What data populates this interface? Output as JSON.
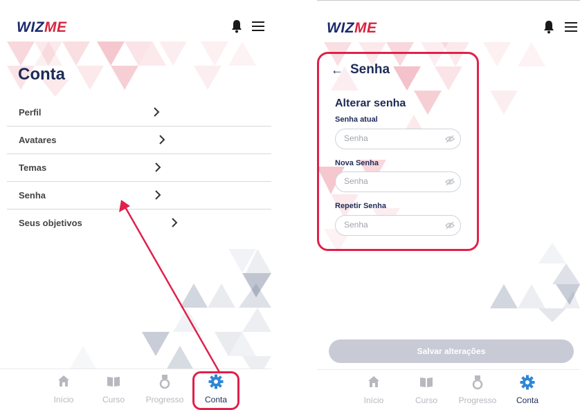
{
  "left_screen": {
    "logo": {
      "part1": "WIZ",
      "part2": "ME"
    },
    "header_title": "Conta",
    "menu": [
      "Perfil",
      "Avatares",
      "Temas",
      "Senha",
      "Seus objetivos"
    ],
    "tabs": [
      "Início",
      "Curso",
      "Progresso",
      "Conta"
    ],
    "active_tab": "Conta"
  },
  "right_screen": {
    "logo": {
      "part1": "WIZ",
      "part2": "ME"
    },
    "back_arrow": "←",
    "header_title": "Senha",
    "section_title": "Alterar senha",
    "fields": [
      {
        "label": "Senha atual",
        "placeholder": "Senha"
      },
      {
        "label": "Nova Senha",
        "placeholder": "Senha"
      },
      {
        "label": "Repetir Senha",
        "placeholder": "Senha"
      }
    ],
    "save_button": "Salvar alterações",
    "tabs": [
      "Início",
      "Curso",
      "Progresso",
      "Conta"
    ],
    "active_tab": "Conta"
  },
  "icons": [
    "bell-icon",
    "hamburger-menu-icon",
    "chevron-right-icon",
    "home-icon",
    "book-icon",
    "medal-icon",
    "gear-icon",
    "eye-off-icon",
    "back-arrow-icon"
  ],
  "colors": {
    "brand_navy": "#1a2a6c",
    "brand_red": "#d6253f",
    "annotation_red": "#e0204a",
    "active_tab": "#1e2a55",
    "inactive_tab": "#b8b8bf"
  }
}
